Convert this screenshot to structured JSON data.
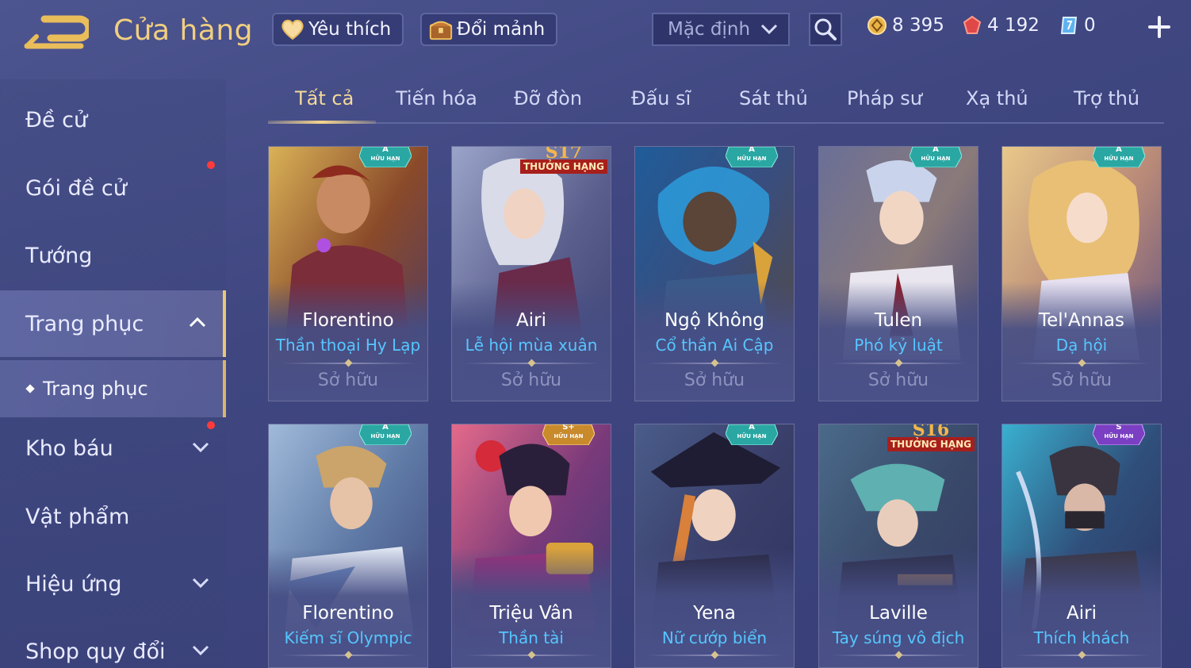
{
  "header": {
    "title": "Cửa hàng",
    "favorite_label": "Yêu thích",
    "exchange_label": "Đổi mảnh",
    "sort_value": "Mặc định",
    "gold": "8 395",
    "gems": "4 192",
    "vouchers": "0"
  },
  "sidebar": {
    "items": [
      {
        "label": "Đề cử"
      },
      {
        "label": "Gói đề cử"
      },
      {
        "label": "Tướng"
      },
      {
        "label": "Trang phục"
      },
      {
        "label": "Kho báu"
      },
      {
        "label": "Vật phẩm"
      },
      {
        "label": "Hiệu ứng"
      },
      {
        "label": "Shop quy đổi"
      }
    ],
    "sub_item": "Trang phục"
  },
  "tabs": [
    "Tất cả",
    "Tiến hóa",
    "Đỡ đòn",
    "Đấu sĩ",
    "Sát thủ",
    "Pháp sư",
    "Xạ thủ",
    "Trợ thủ"
  ],
  "cards": [
    {
      "hero": "Florentino",
      "skin": "Thần thoại Hy Lạp",
      "status": "Sở hữu",
      "badge": "A",
      "badge_sub": "HỮU HẠN"
    },
    {
      "hero": "Airi",
      "skin": "Lễ hội mùa xuân",
      "status": "Sở hữu",
      "badge": "S17",
      "badge_sub": "THƯỞNG HẠNG"
    },
    {
      "hero": "Ngộ Không",
      "skin": "Cổ thần Ai Cập",
      "status": "Sở hữu",
      "badge": "A",
      "badge_sub": "HỮU HẠN"
    },
    {
      "hero": "Tulen",
      "skin": "Phó kỷ luật",
      "status": "Sở hữu",
      "badge": "A",
      "badge_sub": "HỮU HẠN"
    },
    {
      "hero": "Tel'Annas",
      "skin": "Dạ hội",
      "status": "Sở hữu",
      "badge": "A",
      "badge_sub": "HỮU HẠN"
    },
    {
      "hero": "Florentino",
      "skin": "Kiếm sĩ Olympic",
      "badge": "A",
      "badge_sub": "HỮU HẠN"
    },
    {
      "hero": "Triệu Vân",
      "skin": "Thần tài",
      "badge": "S+",
      "badge_sub": "HỮU HẠN"
    },
    {
      "hero": "Yena",
      "skin": "Nữ cướp biển",
      "badge": "A",
      "badge_sub": "HỮU HẠN"
    },
    {
      "hero": "Laville",
      "skin": "Tay súng vô địch",
      "badge": "S16",
      "badge_sub": "THƯỞNG HẠNG"
    },
    {
      "hero": "Airi",
      "skin": "Thích khách",
      "badge": "S",
      "badge_sub": "HỮU HẠN"
    }
  ],
  "colors": {
    "accent_gold": "#f1cf80",
    "skin_blue": "#56c6ff",
    "badge_teal": "#2aa7a3",
    "badge_gold": "#c98a2c",
    "badge_purple": "#7a3fc2",
    "rank_red": "#a71f1c"
  }
}
